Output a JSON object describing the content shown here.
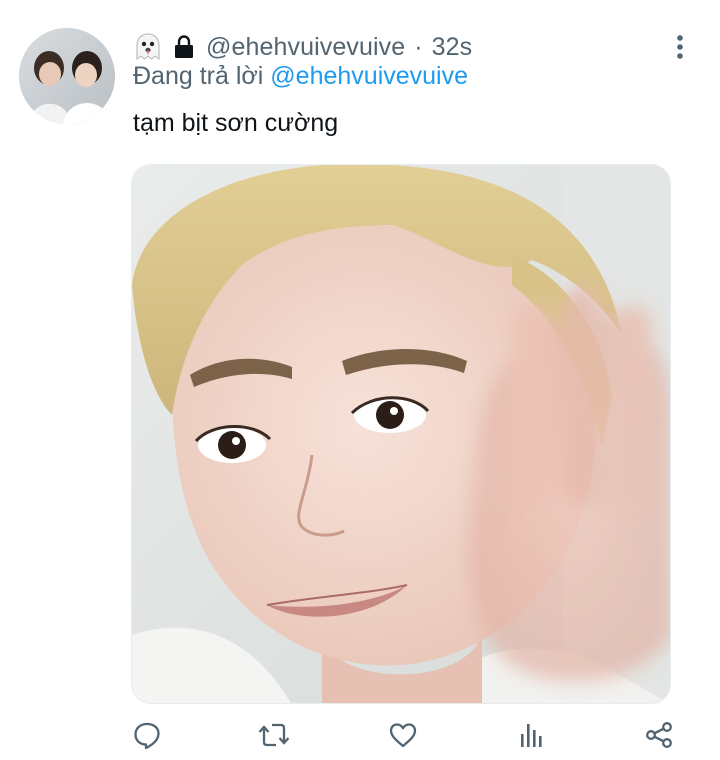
{
  "tweet": {
    "author_handle": "@ehehvuivevuive",
    "separator": "·",
    "time": "32s",
    "reply_prefix": "Đang trả lời",
    "reply_to": "@ehehvuivevuive",
    "text": "tạm bịt sơn cường"
  },
  "icons": {
    "badge": "ghost-emoji-icon",
    "protected": "lock-icon",
    "menu": "more-vertical-icon",
    "reply": "reply-icon",
    "retweet": "retweet-icon",
    "like": "heart-icon",
    "analytics": "analytics-icon",
    "share": "share-icon"
  },
  "colors": {
    "text_primary": "#0f1419",
    "text_secondary": "#536471",
    "link": "#1d9bf0",
    "icon_gray": "#536471"
  }
}
